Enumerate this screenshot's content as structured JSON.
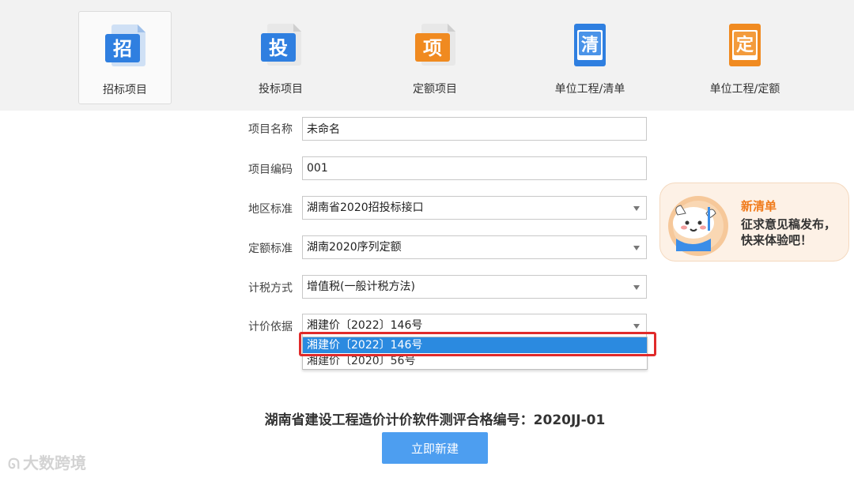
{
  "toolbar": {
    "items": [
      {
        "label": "招标项目",
        "glyph": "招",
        "icon": "bid-project-icon",
        "color": "#2f7fe0"
      },
      {
        "label": "投标项目",
        "glyph": "投",
        "icon": "tender-project-icon",
        "color": "#2f7fe0"
      },
      {
        "label": "定额项目",
        "glyph": "项",
        "icon": "quota-project-icon",
        "color": "#f08a20"
      },
      {
        "label": "单位工程/清单",
        "glyph": "清",
        "icon": "unit-list-icon",
        "color": "#2f7fe0"
      },
      {
        "label": "单位工程/定额",
        "glyph": "定",
        "icon": "unit-quota-icon",
        "color": "#f08a20"
      }
    ],
    "active_index": 0
  },
  "form": {
    "project_name": {
      "label": "项目名称",
      "value": "未命名"
    },
    "project_code": {
      "label": "项目编码",
      "value": "001"
    },
    "region_standard": {
      "label": "地区标准",
      "value": "湖南省2020招投标接口"
    },
    "quota_standard": {
      "label": "定额标准",
      "value": "湖南2020序列定额"
    },
    "tax_method": {
      "label": "计税方式",
      "value": "增值税(一般计税方法)"
    },
    "pricing_basis": {
      "label": "计价依据",
      "value": "湘建价〔2022〕146号",
      "options": [
        "湘建价〔2022〕146号",
        "湘建价〔2020〕56号"
      ],
      "highlighted_index": 0
    }
  },
  "promo": {
    "title": "新清单",
    "text": "征求意见稿发布，快来体验吧！",
    "icon": "mascot-icon"
  },
  "certification": "湖南省建设工程造价计价软件测评合格编号：2020JJ-01",
  "create_button": "立即新建",
  "watermark": {
    "text": "大数跨境",
    "icon": "watermark-logo-icon"
  },
  "colors": {
    "accent_blue": "#2f7fe0",
    "accent_orange": "#f08a20",
    "selection_blue": "#2b8ae0",
    "highlight_red": "#e02a2a",
    "button_blue": "#4d9ef0"
  }
}
